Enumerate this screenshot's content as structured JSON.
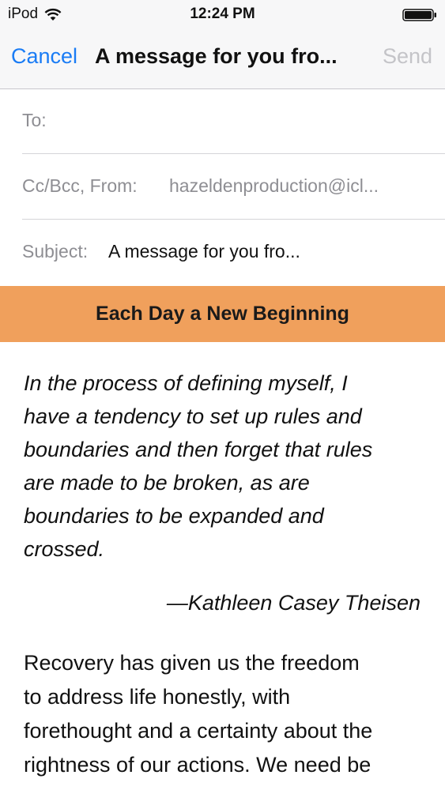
{
  "status_bar": {
    "carrier": "iPod",
    "time": "12:24 PM",
    "wifi_icon": "wifi-icon",
    "battery_icon": "battery-icon"
  },
  "nav": {
    "cancel_label": "Cancel",
    "title": "A message for you fro...",
    "send_label": "Send"
  },
  "fields": {
    "to_label": "To:",
    "to_value": "",
    "ccbcc_label": "Cc/Bcc, From:",
    "ccbcc_value": "hazeldenproduction@icl...",
    "subject_label": "Subject:",
    "subject_value": "A message for you fro..."
  },
  "banner": {
    "title": "Each Day a New Beginning"
  },
  "body": {
    "quote_lines": [
      "In the process of defining myself, I",
      "have a tendency to set up rules and",
      "boundaries and then forget that rules",
      "are made to be broken, as are",
      "boundaries to be expanded and",
      "crossed."
    ],
    "quote_author": "—Kathleen Casey Theisen",
    "text_lines": [
      "Recovery has given us the freedom",
      "to address life honestly, with",
      "forethought and a certainty about the",
      "rightness of our actions. We need be"
    ]
  },
  "colors": {
    "accent": "#1a7cf5",
    "banner": "#f0a05c",
    "disabled": "#c4c4c8",
    "label_gray": "#8e8e93"
  }
}
